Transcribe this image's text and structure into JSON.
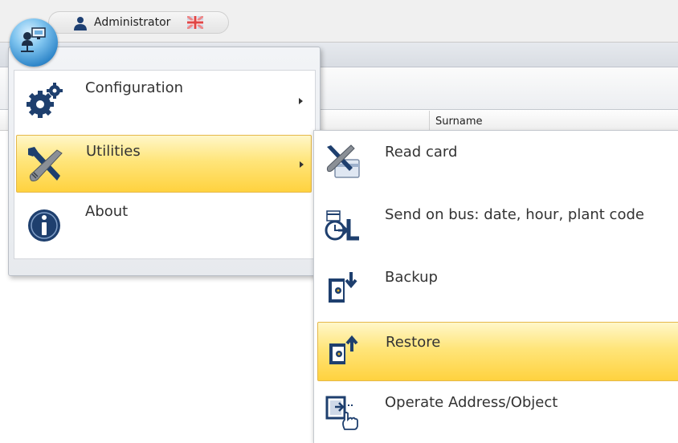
{
  "header": {
    "user_name": "Administrator"
  },
  "grid": {
    "columns": [
      "Surname"
    ]
  },
  "main_menu": {
    "items": [
      {
        "label": "Configuration",
        "icon": "gears-icon",
        "has_submenu": true
      },
      {
        "label": "Utilities",
        "icon": "tools-icon",
        "has_submenu": true,
        "highlighted": true
      },
      {
        "label": "About",
        "icon": "info-icon",
        "has_submenu": false
      }
    ]
  },
  "sub_menu": {
    "items": [
      {
        "label": "Read card",
        "icon": "read-card-icon"
      },
      {
        "label": "Send on bus: date, hour, plant code",
        "icon": "send-on-bus-icon"
      },
      {
        "label": "Backup",
        "icon": "backup-icon"
      },
      {
        "label": "Restore",
        "icon": "restore-icon",
        "highlighted": true
      },
      {
        "label": "Operate Address/Object",
        "icon": "operate-address-icon"
      }
    ]
  },
  "colors": {
    "highlight_top": "#fff7c9",
    "highlight_bottom": "#ffd23f",
    "icon_blue": "#1e3f6e"
  }
}
